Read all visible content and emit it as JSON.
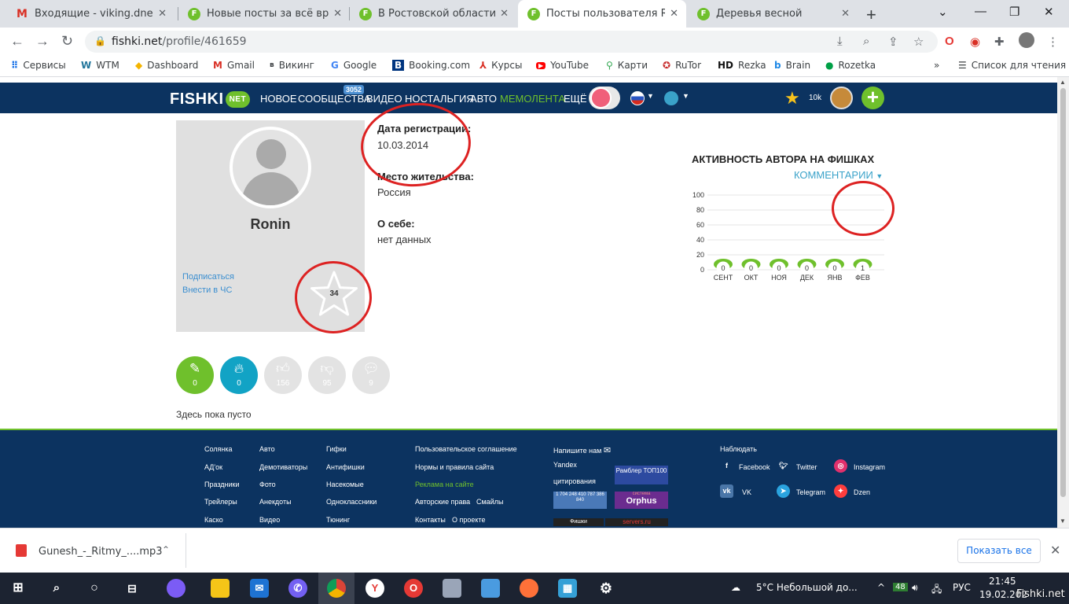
{
  "browser": {
    "tabs": [
      {
        "title": "Входящие - viking.dnepropetrovsk",
        "favicon": "gmail-icon"
      },
      {
        "title": "Новые посты за всё время",
        "favicon": "fishki-icon"
      },
      {
        "title": "В Ростовской области разо",
        "favicon": "fishki-icon"
      },
      {
        "title": "Посты пользователя Ronin",
        "favicon": "fishki-icon"
      },
      {
        "title": "Деревья весной",
        "favicon": "fishki-icon"
      }
    ],
    "active_tab": 3,
    "url_host": "fishki.net",
    "url_path": "/profile/461659",
    "bookmarks": [
      {
        "label": "Сервисы",
        "icon": "apps-icon"
      },
      {
        "label": "WTM",
        "icon": "wordpress-icon"
      },
      {
        "label": "Dashboard",
        "icon": "dashboard-icon"
      },
      {
        "label": "Gmail",
        "icon": "gmail-icon"
      },
      {
        "label": "Викинг",
        "icon": "viking-icon"
      },
      {
        "label": "Google",
        "icon": "google-icon"
      },
      {
        "label": "Booking.com",
        "icon": "booking-icon"
      },
      {
        "label": "Курсы",
        "icon": "courses-icon"
      },
      {
        "label": "YouTube",
        "icon": "youtube-icon"
      },
      {
        "label": "Карти",
        "icon": "maps-icon"
      },
      {
        "label": "RuTor",
        "icon": "rutor-icon"
      },
      {
        "label": "Rezka",
        "icon": "rezka-icon"
      },
      {
        "label": "Brain",
        "icon": "brain-icon"
      },
      {
        "label": "Rozetka",
        "icon": "rozetka-icon"
      }
    ],
    "reading_list": "Список для чтения"
  },
  "site": {
    "logo": "FISHKI",
    "logo_badge": "NET",
    "nav": [
      "НОВОЕ",
      "СООБЩЕСТВА",
      "ВИДЕО",
      "НОСТАЛЬГИЯ",
      "АВТО",
      "МЕМОЛЕНТА",
      "ЕЩЁ"
    ],
    "communities_badge": "3052",
    "points": "10k"
  },
  "profile": {
    "username": "Ronin",
    "subscribe": "Подписаться",
    "blacklist": "Внести в ЧС",
    "rating": "34",
    "reg_label": "Дата регистрации:",
    "reg_value": "10.03.2014",
    "place_label": "Место жительства:",
    "place_value": "Россия",
    "about_label": "О себе:",
    "about_value": "нет данных"
  },
  "stats": [
    {
      "icon": "pencil-icon",
      "count": "0",
      "color": "#6fc02c"
    },
    {
      "icon": "fire-icon",
      "count": "0",
      "color": "#12a3c5"
    },
    {
      "icon": "thumbs-up-icon",
      "count": "156",
      "color": "#e3e3e3"
    },
    {
      "icon": "thumbs-down-icon",
      "count": "95",
      "color": "#e3e3e3"
    },
    {
      "icon": "comment-icon",
      "count": "9",
      "color": "#e3e3e3"
    }
  ],
  "empty_text": "Здесь пока пусто",
  "chart_data": {
    "type": "bar",
    "title": "АКТИВНОСТЬ АВТОРА НА ФИШКАХ",
    "subtitle": "КОММЕНТАРИИ",
    "categories": [
      "СЕНТ",
      "ОКТ",
      "НОЯ",
      "ДЕК",
      "ЯНВ",
      "ФЕВ"
    ],
    "values": [
      0,
      0,
      0,
      0,
      0,
      1
    ],
    "yticks": [
      "100",
      "80",
      "60",
      "40",
      "20",
      "0"
    ],
    "ylim": [
      0,
      100
    ],
    "bar_color": "#6fc02c",
    "grid": true
  },
  "footer": {
    "col1": [
      "Солянка",
      "АД'ок",
      "Праздники",
      "Трейлеры",
      "Каско"
    ],
    "col2": [
      "Авто",
      "Демотиваторы",
      "Фото",
      "Анекдоты",
      "Видео"
    ],
    "col3": [
      "Гифки",
      "Антифишки",
      "Насекомые",
      "Одноклассники",
      "Тюнинг"
    ],
    "col4": [
      "Пользовательское соглашение",
      "Нормы и правила сайта",
      "Реклама на сайте",
      "Авторские права",
      "Контакты"
    ],
    "col4_extra": [
      "Смайлы",
      "О проекте"
    ],
    "write_us": "Напишите нам",
    "yandex_alt": "Yandex цитирования",
    "rambler": "Рамблер ТОП100",
    "liveinternet": "1 704 248 410 787 386 840",
    "orphus": "Orphus",
    "orphus_top": "система",
    "fishki_counter": "Фишки",
    "servers": "servers.ru",
    "follow": "Наблюдать",
    "social": [
      {
        "name": "Facebook",
        "icon": "facebook-icon",
        "color": "#3b5998"
      },
      {
        "name": "Twitter",
        "icon": "twitter-icon",
        "color": "#1da1f2"
      },
      {
        "name": "Instagram",
        "icon": "instagram-icon",
        "color": "#e1306c"
      },
      {
        "name": "VK",
        "icon": "vk-icon",
        "color": "#4a76a8"
      },
      {
        "name": "Telegram",
        "icon": "telegram-icon",
        "color": "#2aa3df"
      },
      {
        "name": "Dzen",
        "icon": "dzen-icon",
        "color": "#ff3d3d"
      }
    ]
  },
  "download": {
    "file": "Gunesh_-_Ritmy_....mp3",
    "show_all": "Показать все"
  },
  "taskbar": {
    "weather": "5°C  Небольшой до...",
    "badge": "48",
    "lang": "РУС",
    "time": "21:45",
    "date": "19.02.202"
  },
  "watermark": "Fishki.net"
}
